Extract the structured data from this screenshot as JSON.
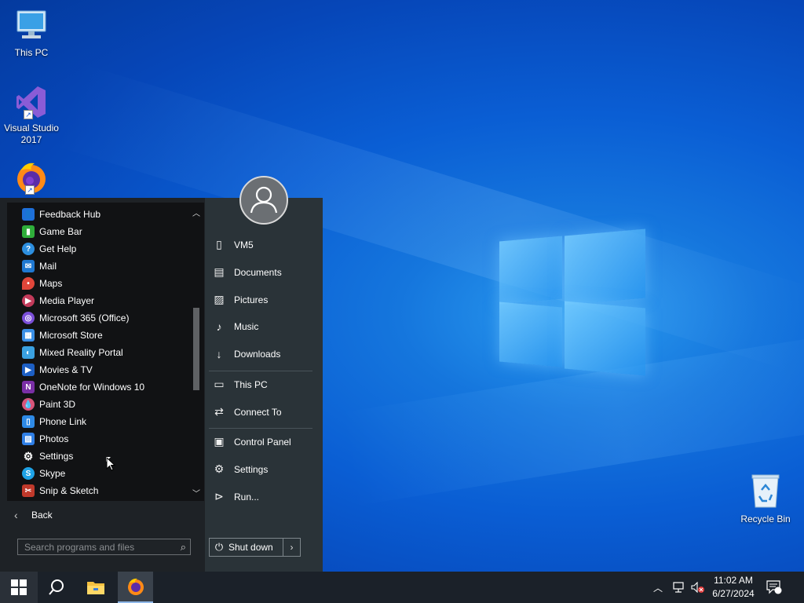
{
  "desktop": {
    "icons": [
      {
        "label": "This PC"
      },
      {
        "label": "Visual Studio 2017"
      },
      {
        "label": "Recycle Bin"
      }
    ]
  },
  "start_menu": {
    "apps": [
      {
        "label": "Feedback Hub",
        "icon": "feedback-hub-icon",
        "color": "#1e6fd9"
      },
      {
        "label": "Game Bar",
        "icon": "game-bar-icon",
        "color": "#2fae3a"
      },
      {
        "label": "Get Help",
        "icon": "get-help-icon",
        "color": "#2d8fe0"
      },
      {
        "label": "Mail",
        "icon": "mail-icon",
        "color": "#1f78d1"
      },
      {
        "label": "Maps",
        "icon": "maps-icon",
        "color": "#e0463a"
      },
      {
        "label": "Media Player",
        "icon": "media-player-icon",
        "color": "#c23a5a"
      },
      {
        "label": "Microsoft 365 (Office)",
        "icon": "office-icon",
        "color": "#7b4fd9"
      },
      {
        "label": "Microsoft Store",
        "icon": "store-icon",
        "color": "#3a8fe6"
      },
      {
        "label": "Mixed Reality Portal",
        "icon": "mixed-reality-icon",
        "color": "#3aa0e0"
      },
      {
        "label": "Movies & TV",
        "icon": "movies-tv-icon",
        "color": "#1d5fc4"
      },
      {
        "label": "OneNote for Windows 10",
        "icon": "onenote-icon",
        "color": "#7a2fa6"
      },
      {
        "label": "Paint 3D",
        "icon": "paint-3d-icon",
        "color": "#d8557a"
      },
      {
        "label": "Phone Link",
        "icon": "phone-link-icon",
        "color": "#2e8ae6"
      },
      {
        "label": "Photos",
        "icon": "photos-icon",
        "color": "#2f7fe6"
      },
      {
        "label": "Settings",
        "icon": "gear-icon",
        "color": "#111214"
      },
      {
        "label": "Skype",
        "icon": "skype-icon",
        "color": "#1ea2e6"
      },
      {
        "label": "Snip & Sketch",
        "icon": "snip-sketch-icon",
        "color": "#c0392b"
      }
    ],
    "back_label": "Back",
    "search_placeholder": "Search programs and files",
    "places": [
      {
        "label": "VM5",
        "icon": "user-folder-icon"
      },
      {
        "label": "Documents",
        "icon": "documents-icon"
      },
      {
        "label": "Pictures",
        "icon": "pictures-icon"
      },
      {
        "label": "Music",
        "icon": "music-icon"
      },
      {
        "label": "Downloads",
        "icon": "downloads-icon"
      },
      {
        "label": "This PC",
        "icon": "computer-icon"
      },
      {
        "label": "Connect To",
        "icon": "connect-to-icon"
      },
      {
        "label": "Control Panel",
        "icon": "control-panel-icon"
      },
      {
        "label": "Settings",
        "icon": "gear-icon"
      },
      {
        "label": "Run...",
        "icon": "run-icon"
      }
    ],
    "shutdown_label": "Shut down"
  },
  "taskbar": {
    "time": "11:02 AM",
    "date": "6/27/2024"
  }
}
